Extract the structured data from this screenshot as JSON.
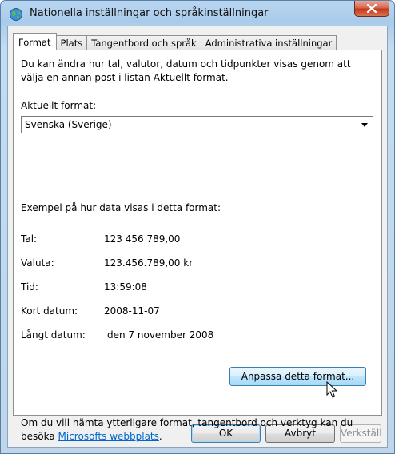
{
  "window": {
    "title": "Nationella inställningar och språkinställningar"
  },
  "tabs": [
    {
      "label": "Format",
      "active": true
    },
    {
      "label": "Plats",
      "active": false
    },
    {
      "label": "Tangentbord och språk",
      "active": false
    },
    {
      "label": "Administrativa inställningar",
      "active": false
    }
  ],
  "format_tab": {
    "description": "Du kan ändra hur tal, valutor, datum och tidpunkter visas genom att välja en annan post i listan Aktuellt format.",
    "current_format_label": "Aktuellt format:",
    "current_format_value": "Svenska (Sverige)",
    "example_title": "Exempel på hur data visas i detta format:",
    "examples": [
      {
        "label": "Tal:",
        "value": "123 456 789,00"
      },
      {
        "label": "Valuta:",
        "value": "123.456.789,00 kr"
      },
      {
        "label": "Tid:",
        "value": "13:59:08"
      },
      {
        "label": "Kort datum:",
        "value": "2008-11-07"
      },
      {
        "label": "Långt datum:",
        "value": "den 7 november 2008"
      }
    ],
    "customize_button": "Anpassa detta format...",
    "footer_text": "Om du vill hämta ytterligare format, tangentbord och verktyg kan du besöka",
    "footer_link": "Microsofts webbplats",
    "footer_end": "."
  },
  "buttons": {
    "ok": "OK",
    "cancel": "Avbryt",
    "apply": "Verkställ"
  },
  "colors": {
    "link": "#0066cc",
    "close_button": "#c2391c"
  }
}
